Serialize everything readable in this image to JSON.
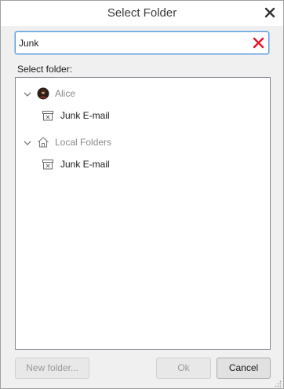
{
  "dialog": {
    "title": "Select Folder"
  },
  "search": {
    "value": "Junk"
  },
  "folder_label": "Select folder:",
  "tree": [
    {
      "label": "Alice",
      "type": "account",
      "icon": "avatar-icon",
      "expanded": true
    },
    {
      "label": "Junk E-mail",
      "type": "folder",
      "icon": "junk-folder-icon"
    },
    {
      "label": "Local Folders",
      "type": "account",
      "icon": "home-icon",
      "expanded": true
    },
    {
      "label": "Junk E-mail",
      "type": "folder",
      "icon": "junk-folder-icon"
    }
  ],
  "buttons": {
    "new_folder": "New folder...",
    "ok": "Ok",
    "cancel": "Cancel"
  },
  "colors": {
    "clear_icon": "#e81123",
    "focus_border": "#5b9bd5"
  }
}
